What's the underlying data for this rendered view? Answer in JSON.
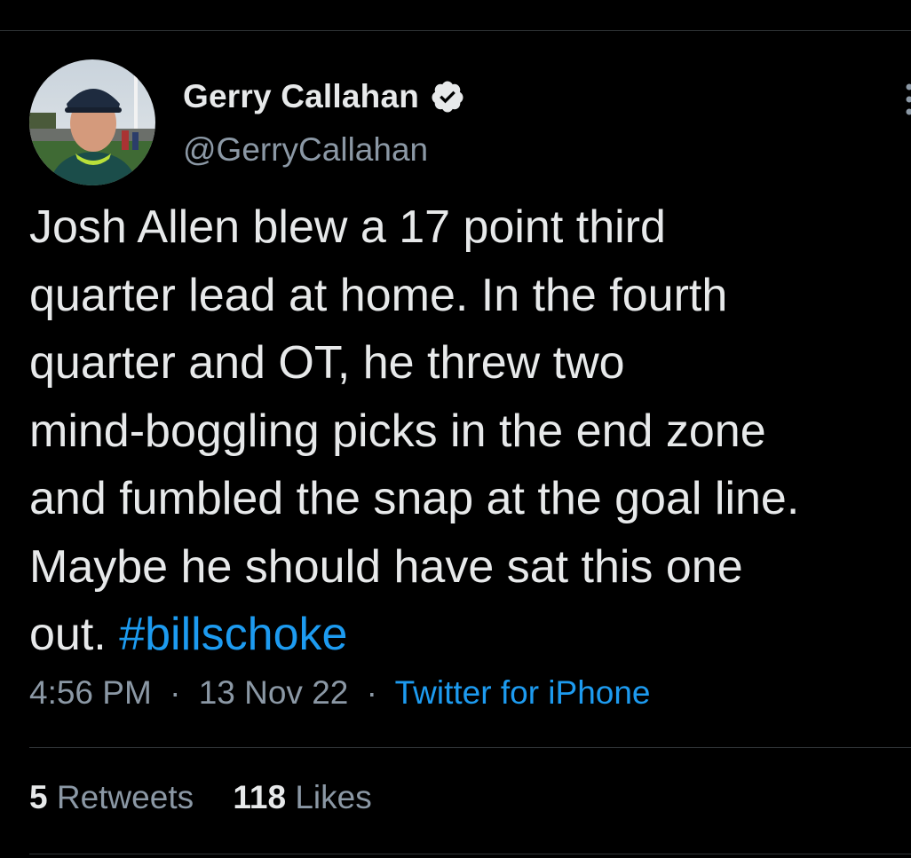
{
  "author": {
    "display_name": "Gerry Callahan",
    "handle": "@GerryCallahan",
    "verified_icon": "verified-badge-icon"
  },
  "tweet": {
    "lines": [
      "Josh Allen blew a 17 point third",
      "quarter lead at home. In the fourth",
      "quarter and OT, he threw two",
      "mind-boggling picks in the end zone",
      "and fumbled the snap at the goal line.",
      "Maybe he should have sat this one"
    ],
    "last_line_prefix": "out. ",
    "hashtag": "#billschoke"
  },
  "meta": {
    "time": "4:56 PM",
    "separator": "·",
    "date": "13 Nov 22",
    "source": "Twitter for iPhone"
  },
  "stats": {
    "retweets_count": "5",
    "retweets_label": "Retweets",
    "likes_count": "118",
    "likes_label": "Likes"
  },
  "colors": {
    "background": "#000000",
    "text_primary": "#e7e9ea",
    "text_secondary": "#8b98a5",
    "link": "#1d9bf0",
    "divider": "#2f3336"
  }
}
